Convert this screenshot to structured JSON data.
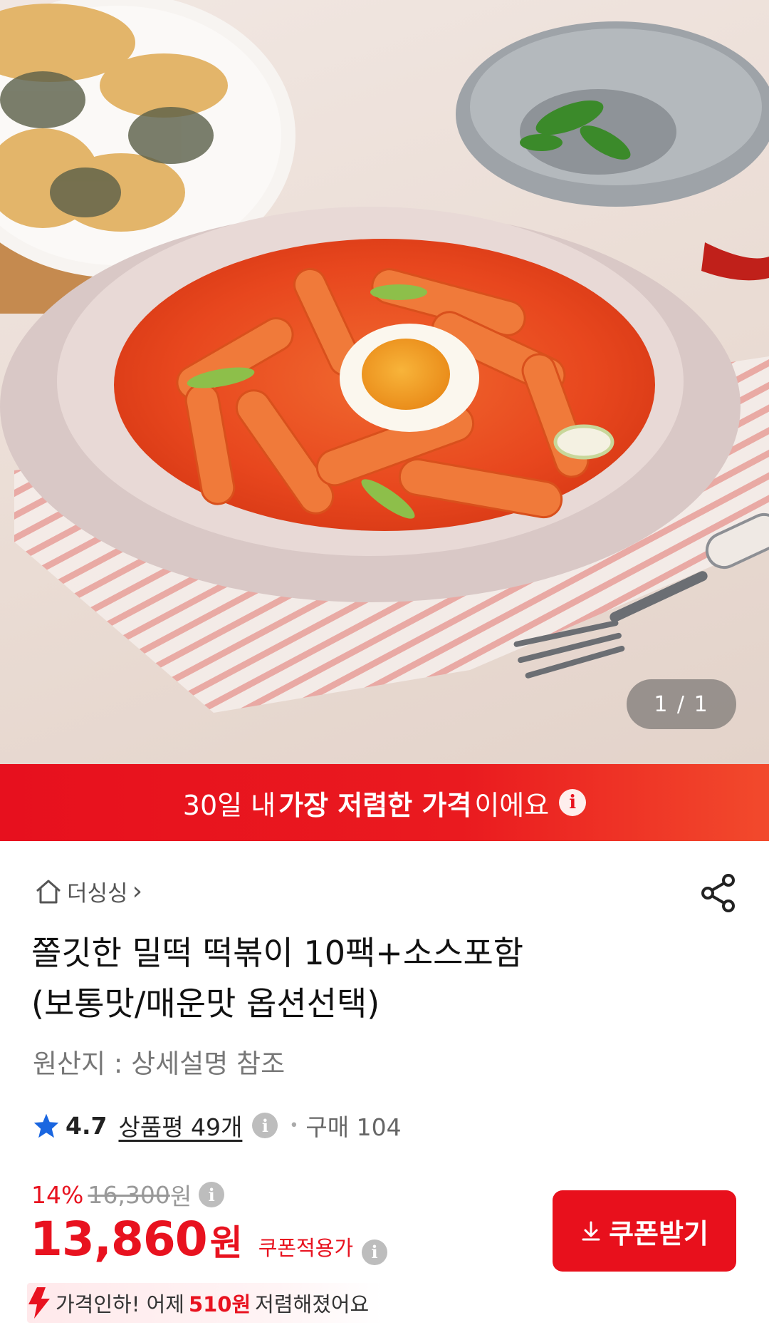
{
  "gallery": {
    "page_indicator": "1 / 1"
  },
  "banner": {
    "prefix": "30일 내",
    "highlight": "가장 저렴한 가격",
    "suffix": "이에요",
    "info_icon": "info-icon"
  },
  "store": {
    "name": "더싱싱",
    "chevron": "›"
  },
  "product": {
    "title_line1": "쫄깃한 밀떡 떡볶이 10팩+소스포함",
    "title_line2": "(보통맛/매운맛 옵션선택)",
    "origin": "원산지 : 상세설명 참조"
  },
  "rating": {
    "score": "4.7",
    "reviews": "상품평 49개",
    "purchase": "구매 104"
  },
  "price": {
    "discount_rate": "14%",
    "original_price": "16,300",
    "original_unit": "원",
    "sale_price": "13,860",
    "sale_unit": "원",
    "coupon_label": "쿠폰적용가",
    "coupon_button": "쿠폰받기"
  },
  "price_drop": {
    "prefix": "가격인하! 어제",
    "amount": "510원",
    "suffix": "저렴해졌어요"
  },
  "colors": {
    "accent": "#e8121f",
    "star": "#1a66e0"
  }
}
